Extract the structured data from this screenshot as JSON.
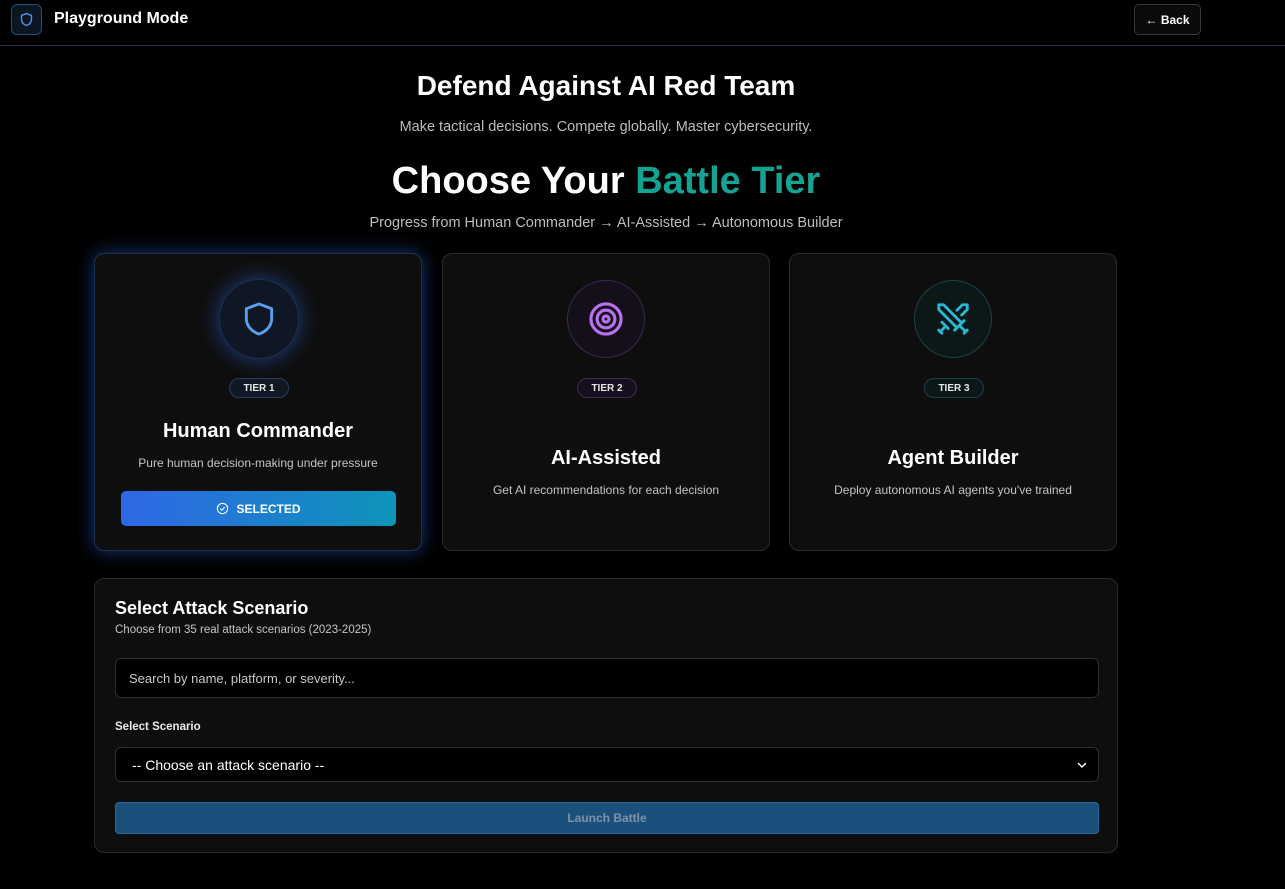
{
  "header": {
    "title": "Playground Mode",
    "back_label": "← Back"
  },
  "hero": {
    "title": "Defend Against AI Red Team",
    "subtitle": "Make tactical decisions. Compete globally. Master cybersecurity."
  },
  "tier_section": {
    "title_prefix": "Choose Your ",
    "title_accent": "Battle Tier",
    "subtitle": "Progress from Human Commander → AI-Assisted → Autonomous Builder"
  },
  "tiers": [
    {
      "badge": "TIER 1",
      "name": "Human Commander",
      "description": "Pure human decision-making under pressure",
      "icon": "shield-icon",
      "selected": true,
      "selected_label": "SELECTED"
    },
    {
      "badge": "TIER 2",
      "name": "AI-Assisted",
      "description": "Get AI recommendations for each decision",
      "icon": "target-icon",
      "selected": false
    },
    {
      "badge": "TIER 3",
      "name": "Agent Builder",
      "description": "Deploy autonomous AI agents you've trained",
      "icon": "crossed-swords-icon",
      "selected": false
    }
  ],
  "scenario_panel": {
    "title": "Select Attack Scenario",
    "subtitle": "Choose from 35 real attack scenarios (2023-2025)",
    "search_placeholder": "Search by name, platform, or severity...",
    "select_label": "Select Scenario",
    "select_value": "-- Choose an attack scenario --",
    "launch_label": "Launch Battle"
  },
  "colors": {
    "accent_teal": "#14a392",
    "tier1": "#5aa0f0",
    "tier2": "#b872f0",
    "tier3": "#29b8d4"
  }
}
